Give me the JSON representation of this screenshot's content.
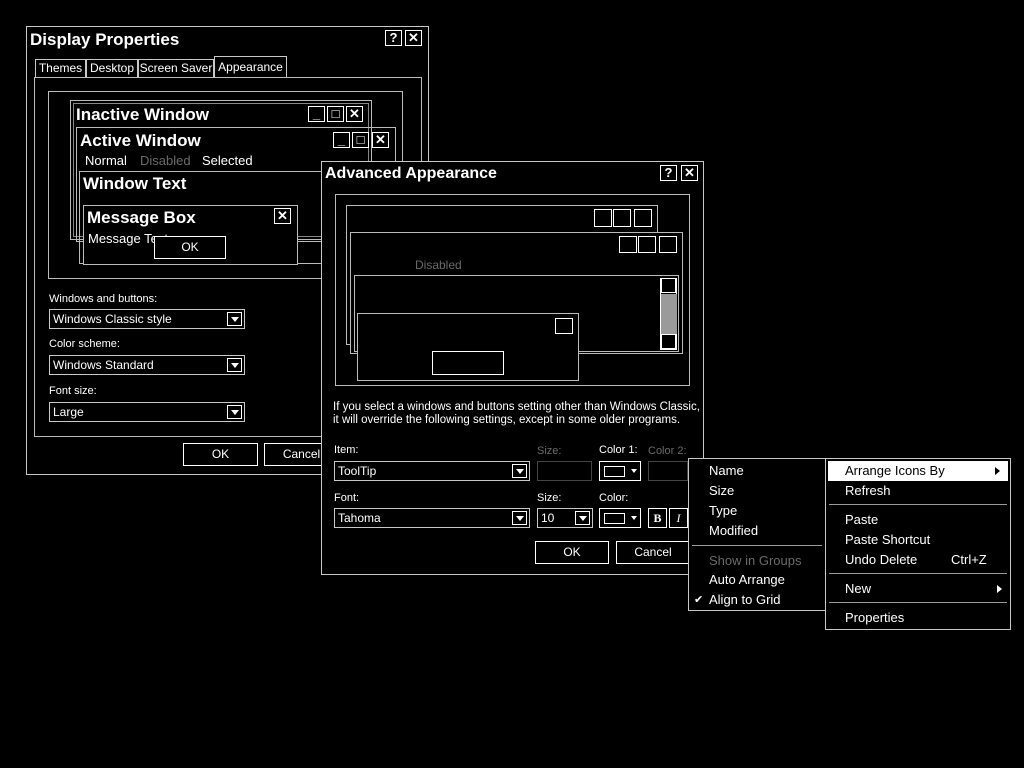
{
  "display_properties": {
    "title": "Display Properties",
    "help_btn": "?",
    "close_btn": "✕",
    "tabs": [
      "Themes",
      "Desktop",
      "Screen Saver",
      "Appearance"
    ],
    "preview": {
      "inactive_window": "Inactive Window",
      "active_window": "Active Window",
      "normal": "Normal",
      "disabled": "Disabled",
      "selected": "Selected",
      "window_text": "Window Text",
      "message_box": "Message Box",
      "message_text": "Message Text",
      "ok": "OK"
    },
    "windows_buttons_label": "Windows and buttons:",
    "windows_buttons_value": "Windows Classic style",
    "color_scheme_label": "Color scheme:",
    "color_scheme_value": "Windows Standard",
    "font_size_label": "Font size:",
    "font_size_value": "Large",
    "ok": "OK",
    "cancel": "Cancel"
  },
  "advanced_appearance": {
    "title": "Advanced Appearance",
    "help_btn": "?",
    "close_btn": "✕",
    "preview_disabled": "Disabled",
    "info_line1": "If you select a windows and buttons setting other than Windows Classic,",
    "info_line2": "it will override the following settings, except in some older programs.",
    "item_label": "Item:",
    "item_value": "ToolTip",
    "size_label": "Size:",
    "color1_label": "Color 1:",
    "color2_label": "Color 2:",
    "font_label": "Font:",
    "font_value": "Tahoma",
    "font_size_label": "Size:",
    "font_size_value": "10",
    "font_color_label": "Color:",
    "bold": "B",
    "italic": "I",
    "ok": "OK",
    "cancel": "Cancel"
  },
  "arrange_submenu": {
    "items": [
      "Name",
      "Size",
      "Type",
      "Modified"
    ],
    "show_in_groups": "Show in Groups",
    "auto_arrange": "Auto Arrange",
    "align_to_grid": "Align to Grid",
    "check": "✔"
  },
  "context_menu": {
    "arrange_icons_by": "Arrange Icons By",
    "refresh": "Refresh",
    "paste": "Paste",
    "paste_shortcut": "Paste Shortcut",
    "undo_delete": "Undo Delete",
    "undo_shortcut": "Ctrl+Z",
    "new": "New",
    "properties": "Properties"
  },
  "colors": {
    "background": "#000000",
    "foreground": "#ffffff",
    "disabled": "#6a6a6a",
    "scrollbar_thumb": "#9a9a9a"
  }
}
